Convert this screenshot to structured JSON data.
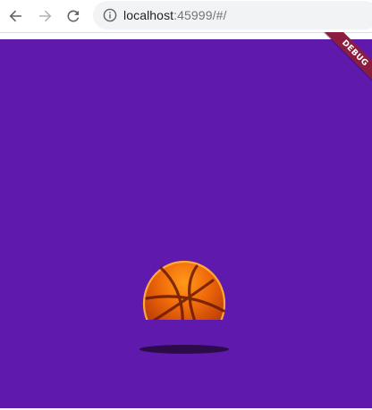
{
  "browser": {
    "url_host": "localhost",
    "url_rest": ":45999/#/",
    "icons": {
      "back": "arrow-left-icon",
      "forward": "arrow-right-icon",
      "reload": "reload-icon",
      "info": "info-icon"
    }
  },
  "app": {
    "background_color": "#5f1aad",
    "debug_banner": "DEBUG",
    "ball": {
      "name": "basketball-icon",
      "color": "#e0600a"
    }
  }
}
